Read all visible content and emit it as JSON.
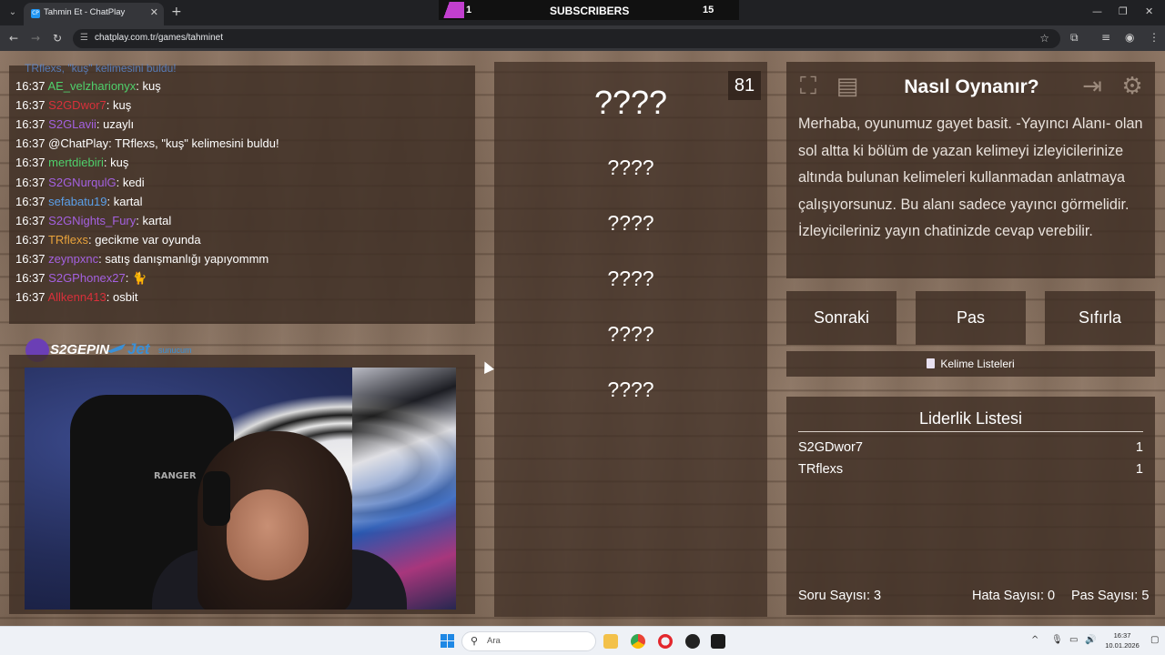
{
  "browser": {
    "tab_title": "Tahmin Et - ChatPlay",
    "tab_favicon": "CP",
    "url": "chatplay.com.tr/games/tahminet",
    "new_tab": "+",
    "close": "✕"
  },
  "subscriber_banner": {
    "left_count": "1",
    "label": "SUBSCRIBERS",
    "right_count": "15"
  },
  "chat": {
    "top_partial": "TRflexs, \"kuş\" kelimesini buldu!",
    "messages": [
      {
        "time": "16:37",
        "user": "AE_velzharionyx",
        "text": "kuş",
        "color": "#4fd06b"
      },
      {
        "time": "16:37",
        "user": "S2GDwor7",
        "text": "kuş",
        "color": "#d8303a"
      },
      {
        "time": "16:37",
        "user": "S2GLavii",
        "text": "uzaylı",
        "color": "#a461e0"
      },
      {
        "time": "16:37",
        "user": "@ChatPlay",
        "text": "TRflexs, \"kuş\" kelimesini buldu!",
        "color": "#ffffff"
      },
      {
        "time": "16:37",
        "user": "mertdiebiri",
        "text": "kuş",
        "color": "#4fd06b"
      },
      {
        "time": "16:37",
        "user": "S2GNurqulG",
        "text": "kedi",
        "color": "#a461e0"
      },
      {
        "time": "16:37",
        "user": "sefabatu19",
        "text": "kartal",
        "color": "#5b9fe8"
      },
      {
        "time": "16:37",
        "user": "S2GNights_Fury",
        "text": "kartal",
        "color": "#a461e0"
      },
      {
        "time": "16:37",
        "user": "TRflexs",
        "text": "gecikme var oyunda",
        "color": "#e8a23b"
      },
      {
        "time": "16:37",
        "user": "zeynpxnc",
        "text": "satış danışmanlığı yapıyommm",
        "color": "#a461e0"
      },
      {
        "time": "16:37",
        "user": "S2GPhonex27",
        "text": "🐈",
        "color": "#a461e0"
      },
      {
        "time": "16:37",
        "user": "Allkenn413",
        "text": "osbit",
        "color": "#d8303a"
      }
    ]
  },
  "sponsors": {
    "s2g": "S2GEPIN",
    "jet": "Jet",
    "jet_sub": "sunucum"
  },
  "webcam": {
    "chair_brand": "RANGER"
  },
  "game": {
    "timer": "81",
    "words": [
      "????",
      "????",
      "????",
      "????",
      "????",
      "????"
    ]
  },
  "how_to_play": {
    "title": "Nasıl Oynanır?",
    "text": "Merhaba, oyunumuz gayet basit. -Yayıncı Alanı- olan sol altta ki bölüm de yazan kelimeyi izleyicilerinize altında bulunan kelimeleri kullanmadan anlatmaya çalışıyorsunuz. Bu alanı sadece yayıncı görmelidir. İzleyicileriniz yayın chatinizde cevap verebilir."
  },
  "buttons": {
    "next": "Sonraki",
    "pass": "Pas",
    "reset": "Sıfırla",
    "word_lists": "Kelime Listeleri"
  },
  "leaderboard": {
    "title": "Liderlik Listesi",
    "entries": [
      {
        "name": "S2GDwor7",
        "score": "1"
      },
      {
        "name": "TRflexs",
        "score": "1"
      }
    ]
  },
  "stats": {
    "questions": "Soru Sayısı: 3",
    "errors": "Hata Sayısı: 0",
    "passes": "Pas Sayısı: 5"
  },
  "taskbar": {
    "search_placeholder": "Ara",
    "time": "16:37",
    "date": "10.01.2026"
  },
  "icons": {
    "fullscreen": "fullscreen-icon",
    "notes": "notes-icon",
    "exit": "exit-icon",
    "settings": "gear-icon"
  }
}
